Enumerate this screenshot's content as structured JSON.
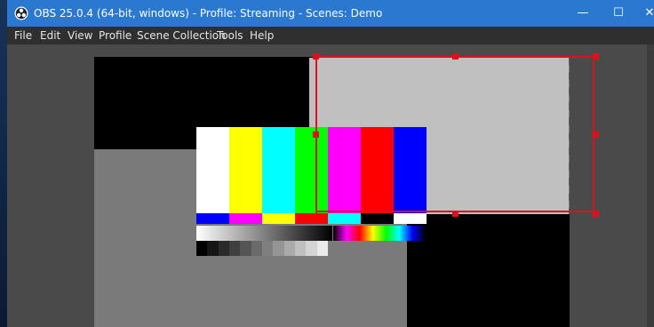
{
  "window": {
    "title": "OBS 25.0.4 (64-bit, windows) - Profile: Streaming - Scenes: Demo",
    "minimize_glyph": "—",
    "maximize_glyph": "☐",
    "close_glyph": "✕"
  },
  "menubar": {
    "items": [
      "File",
      "Edit",
      "View",
      "Profile",
      "Scene Collection",
      "Tools",
      "Help"
    ]
  },
  "colors": {
    "titlebar": "#2b78d0",
    "selection": "#e0101a",
    "workspace": "#4a4a4a"
  },
  "icons": {
    "app": "obs-logo-icon"
  }
}
